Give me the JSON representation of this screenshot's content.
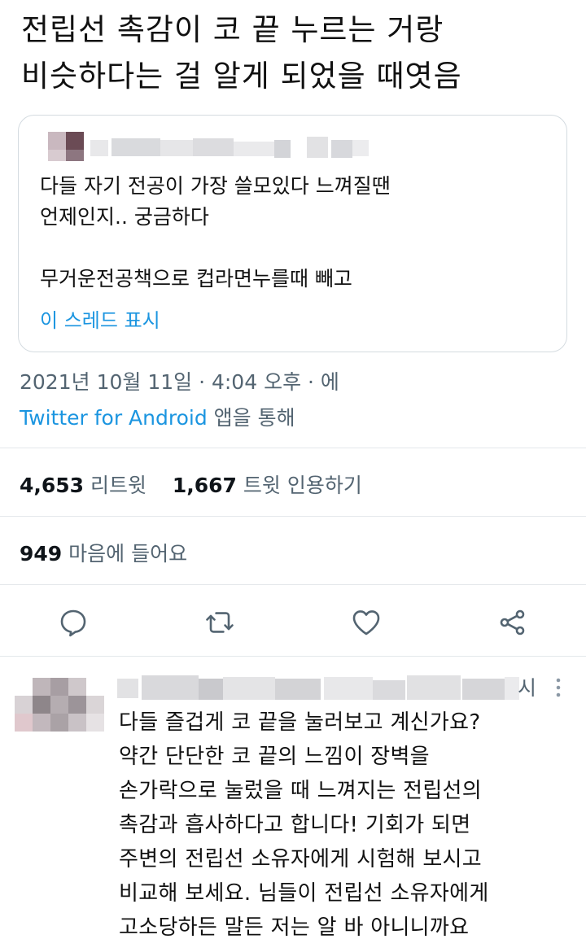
{
  "tweet": {
    "text_lines": [
      "전립선 촉감이 코 끝 누르는 거랑",
      "비슷하다는 걸 알게 되었을 때엿음"
    ]
  },
  "quote": {
    "lines": [
      "다들 자기 전공이 가장 쓸모있다 느껴질땐",
      "언제인지.. 궁금하다",
      "",
      "무거운전공책으로 컵라면누를때 빼고"
    ],
    "show_thread": "이 스레드 표시"
  },
  "meta": {
    "timestamp": "2021년 10월 11일 · 4:04 오후 · 에",
    "source_app": "Twitter for Android",
    "source_suffix": " 앱을 통해"
  },
  "stats": {
    "retweets_count": "4,653",
    "retweets_label": "리트윗",
    "quotes_count": "1,667",
    "quotes_label": "트윗 인용하기",
    "likes_count": "949",
    "likes_label": "마음에 들어요"
  },
  "actions": [
    "reply-icon",
    "retweet-icon",
    "like-icon",
    "share-icon"
  ],
  "reply": {
    "header_suffix": "시",
    "lines": [
      "다들 즐겁게 코 끝을 눌러보고 계신가요?",
      "약간 단단한 코 끝의 느낌이 장벽을",
      "손가락으로 눌렀을 때 느껴지는 전립선의",
      "촉감과 흡사하다고 합니다! 기회가 되면",
      "주변의 전립선 소유자에게 시험해 보시고",
      "비교해 보세요. 님들이 전립선 소유자에게",
      "고소당하든 말든 저는 알 바 아니니까요"
    ]
  },
  "colors": {
    "accent": "#1b95e0",
    "muted": "#536471",
    "divider": "#e4e8eb"
  }
}
